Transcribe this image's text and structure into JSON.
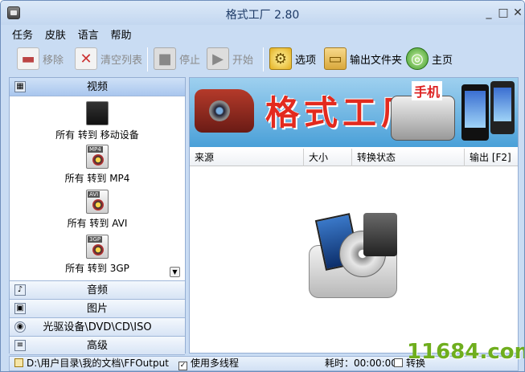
{
  "window": {
    "title": "格式工厂 2.80",
    "controls": [
      "_",
      "□",
      "✕"
    ]
  },
  "menu": [
    "任务",
    "皮肤",
    "语言",
    "帮助"
  ],
  "toolbar": {
    "remove": "移除",
    "clear": "清空列表",
    "stop": "停止",
    "start": "开始",
    "options": "选项",
    "output_folder": "输出文件夹",
    "home": "主页"
  },
  "sidebar": {
    "video": "视频",
    "video_items": [
      {
        "label": "所有 转到 移动设备",
        "badge": ""
      },
      {
        "label": "所有 转到 MP4",
        "badge": "MP4"
      },
      {
        "label": "所有 转到 AVI",
        "badge": "AVI"
      },
      {
        "label": "所有 转到 3GP",
        "badge": "3GP"
      }
    ],
    "audio": "音频",
    "picture": "图片",
    "optical": "光驱设备\\DVD\\CD\\ISO",
    "advanced": "高级"
  },
  "banner": {
    "main_text": "格式工厂",
    "sub_text": "手机"
  },
  "table": {
    "cols": [
      "来源",
      "大小",
      "转换状态",
      "输出 [F2]"
    ]
  },
  "status": {
    "path": "D:\\用户目录\\我的文档\\FFOutput",
    "multithread": "使用多线程",
    "elapsed": "耗时：00:00:00",
    "after": "转换"
  },
  "watermark": "11684.com"
}
